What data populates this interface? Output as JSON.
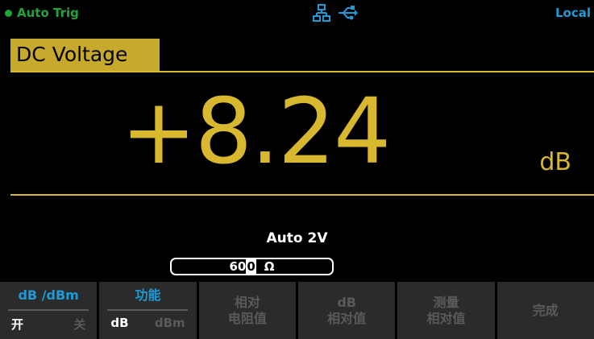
{
  "status": {
    "trigger_mode": "Auto  Trig",
    "remote_state": "Local",
    "icons": [
      "network-icon",
      "usb-icon"
    ],
    "colors": {
      "trigger": "#1fa53c",
      "remote": "#1e9ad6"
    }
  },
  "measurement": {
    "function": "DC Voltage",
    "reading": "+8.24",
    "unit": "dB",
    "range": "Auto  2V",
    "colors": {
      "reading": "#d8b82e",
      "function_tag": "#c7a92b"
    }
  },
  "input": {
    "value_prefix": "60",
    "value_cursor": "0",
    "unit": "Ω"
  },
  "softkeys": [
    {
      "title": "dB /dBm",
      "on": "开",
      "off": "关"
    },
    {
      "title": "功能",
      "on": "dB",
      "off": "dBm"
    },
    {
      "line1": "相对",
      "line2": "电阻值"
    },
    {
      "line1": "dB",
      "line2": "相对值"
    },
    {
      "line1": "测量",
      "line2": "相对值"
    },
    {
      "line1": "完成"
    }
  ]
}
